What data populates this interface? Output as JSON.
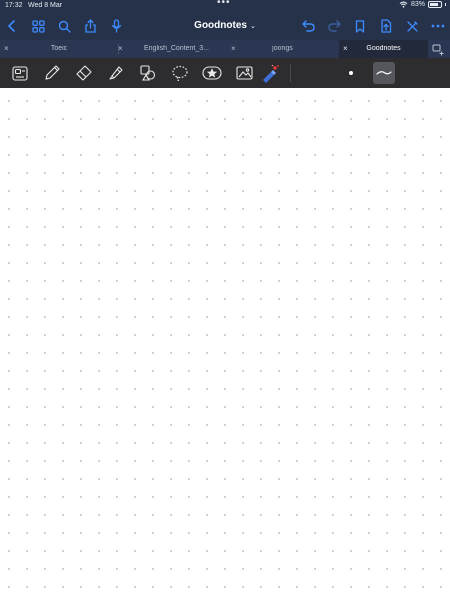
{
  "status_bar": {
    "time": "17:32",
    "date": "Wed 8 Mar",
    "battery_text": "83%",
    "battery_level": 0.83
  },
  "nav": {
    "title": "Goodnotes",
    "icons": [
      "back-chevron-icon",
      "grid-icon",
      "search-icon",
      "share-icon",
      "microphone-icon",
      "undo-icon",
      "redo-icon",
      "bookmark-icon",
      "export-icon",
      "pen-off-icon",
      "more-icon"
    ]
  },
  "tabs": [
    {
      "label": "Toeic",
      "active": false
    },
    {
      "label": "English_Content_3...",
      "active": false
    },
    {
      "label": "joongs",
      "active": false
    },
    {
      "label": "Goodnotes",
      "active": true
    }
  ],
  "toolbar": {
    "tools": [
      "zoom-window-icon",
      "pen-icon",
      "eraser-icon",
      "highlighter-icon",
      "shapes-icon",
      "lasso-icon",
      "elements-icon",
      "image-icon",
      "laser-pointer-icon"
    ],
    "selected_stroke": "thin-stroke"
  },
  "colors": {
    "nav_bg": "#25324a",
    "tab_bg": "#2b3752",
    "toolbar_bg": "#2d2d2f",
    "accent": "#3d8bff"
  }
}
